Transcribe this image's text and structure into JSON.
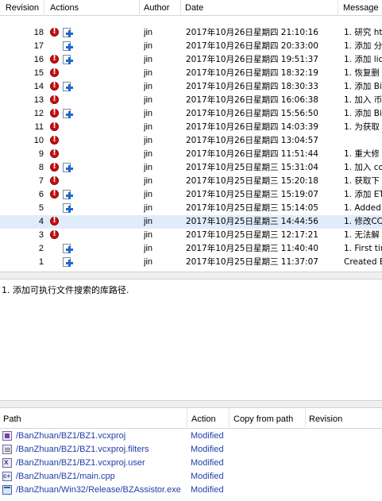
{
  "log_table": {
    "columns": {
      "revision": "Revision",
      "actions": "Actions",
      "author": "Author",
      "date": "Date",
      "message": "Message"
    },
    "rows": [
      {
        "rev": "18",
        "del": true,
        "mod": true,
        "author": "jin",
        "date": "2017年10月26日星期四 21:10:16",
        "msg": "1. 研究 ht"
      },
      {
        "rev": "17",
        "del": false,
        "mod": true,
        "author": "jin",
        "date": "2017年10月26日星期四 20:33:00",
        "msg": "1. 添加 分"
      },
      {
        "rev": "16",
        "del": true,
        "mod": true,
        "author": "jin",
        "date": "2017年10月26日星期四 19:51:37",
        "msg": "1. 添加 lic"
      },
      {
        "rev": "15",
        "del": true,
        "mod": false,
        "author": "jin",
        "date": "2017年10月26日星期四 18:32:19",
        "msg": "1. 恢复删"
      },
      {
        "rev": "14",
        "del": true,
        "mod": true,
        "author": "jin",
        "date": "2017年10月26日星期四 18:30:33",
        "msg": "1. 添加 Bi"
      },
      {
        "rev": "13",
        "del": true,
        "mod": false,
        "author": "jin",
        "date": "2017年10月26日星期四 16:06:38",
        "msg": "1. 加入 币"
      },
      {
        "rev": "12",
        "del": true,
        "mod": true,
        "author": "jin",
        "date": "2017年10月26日星期四 15:56:50",
        "msg": "1. 添加 Bi"
      },
      {
        "rev": "11",
        "del": true,
        "mod": false,
        "author": "jin",
        "date": "2017年10月26日星期四 14:03:39",
        "msg": "1. 为获取"
      },
      {
        "rev": "10",
        "del": true,
        "mod": false,
        "author": "jin",
        "date": "2017年10月26日星期四 13:04:57",
        "msg": ""
      },
      {
        "rev": "9",
        "del": true,
        "mod": false,
        "author": "jin",
        "date": "2017年10月26日星期四 11:51:44",
        "msg": "1. 重大修"
      },
      {
        "rev": "8",
        "del": true,
        "mod": true,
        "author": "jin",
        "date": "2017年10月25日星期三 15:31:04",
        "msg": "1. 加入 co"
      },
      {
        "rev": "7",
        "del": true,
        "mod": false,
        "author": "jin",
        "date": "2017年10月25日星期三 15:20:18",
        "msg": "1. 获取下"
      },
      {
        "rev": "6",
        "del": true,
        "mod": true,
        "author": "jin",
        "date": "2017年10月25日星期三 15:19:07",
        "msg": "1. 添加 ET"
      },
      {
        "rev": "5",
        "del": false,
        "mod": true,
        "author": "jin",
        "date": "2017年10月25日星期三 15:14:05",
        "msg": "1. Added l"
      },
      {
        "rev": "4",
        "del": true,
        "mod": false,
        "author": "jin",
        "date": "2017年10月25日星期三 14:44:56",
        "msg": "1. 修改CC",
        "selected": true
      },
      {
        "rev": "3",
        "del": true,
        "mod": false,
        "author": "jin",
        "date": "2017年10月25日星期三 12:17:21",
        "msg": "1. 无法解"
      },
      {
        "rev": "2",
        "del": false,
        "mod": true,
        "author": "jin",
        "date": "2017年10月25日星期三 11:40:40",
        "msg": "1. First tim"
      },
      {
        "rev": "1",
        "del": false,
        "mod": true,
        "author": "jin",
        "date": "2017年10月25日星期三 11:37:07",
        "msg": "Created B"
      }
    ]
  },
  "message_panel": {
    "text": "1. 添加可执行文件搜索的库路径."
  },
  "paths_table": {
    "columns": {
      "path": "Path",
      "action": "Action",
      "copy_from": "Copy from path",
      "revision": "Revision"
    },
    "rows": [
      {
        "icon": "vcxproj-file-icon",
        "kind": "vs",
        "path": "/BanZhuan/BZ1/BZ1.vcxproj",
        "action": "Modified"
      },
      {
        "icon": "filters-file-icon",
        "kind": "flt",
        "path": "/BanZhuan/BZ1/BZ1.vcxproj.filters",
        "action": "Modified"
      },
      {
        "icon": "user-file-icon",
        "kind": "usr",
        "path": "/BanZhuan/BZ1/BZ1.vcxproj.user",
        "action": "Modified"
      },
      {
        "icon": "cpp-file-icon",
        "kind": "cpp",
        "path": "/BanZhuan/BZ1/main.cpp",
        "action": "Modified"
      },
      {
        "icon": "exe-file-icon",
        "kind": "exe",
        "path": "/BanZhuan/Win32/Release/BZAssistor.exe",
        "action": "Modified"
      }
    ]
  },
  "colors": {
    "selected_row": "#e1ecfa",
    "link_text": "#1f3ea8",
    "delete_icon": "#cc1010",
    "modify_icon": "#1f67c9"
  }
}
